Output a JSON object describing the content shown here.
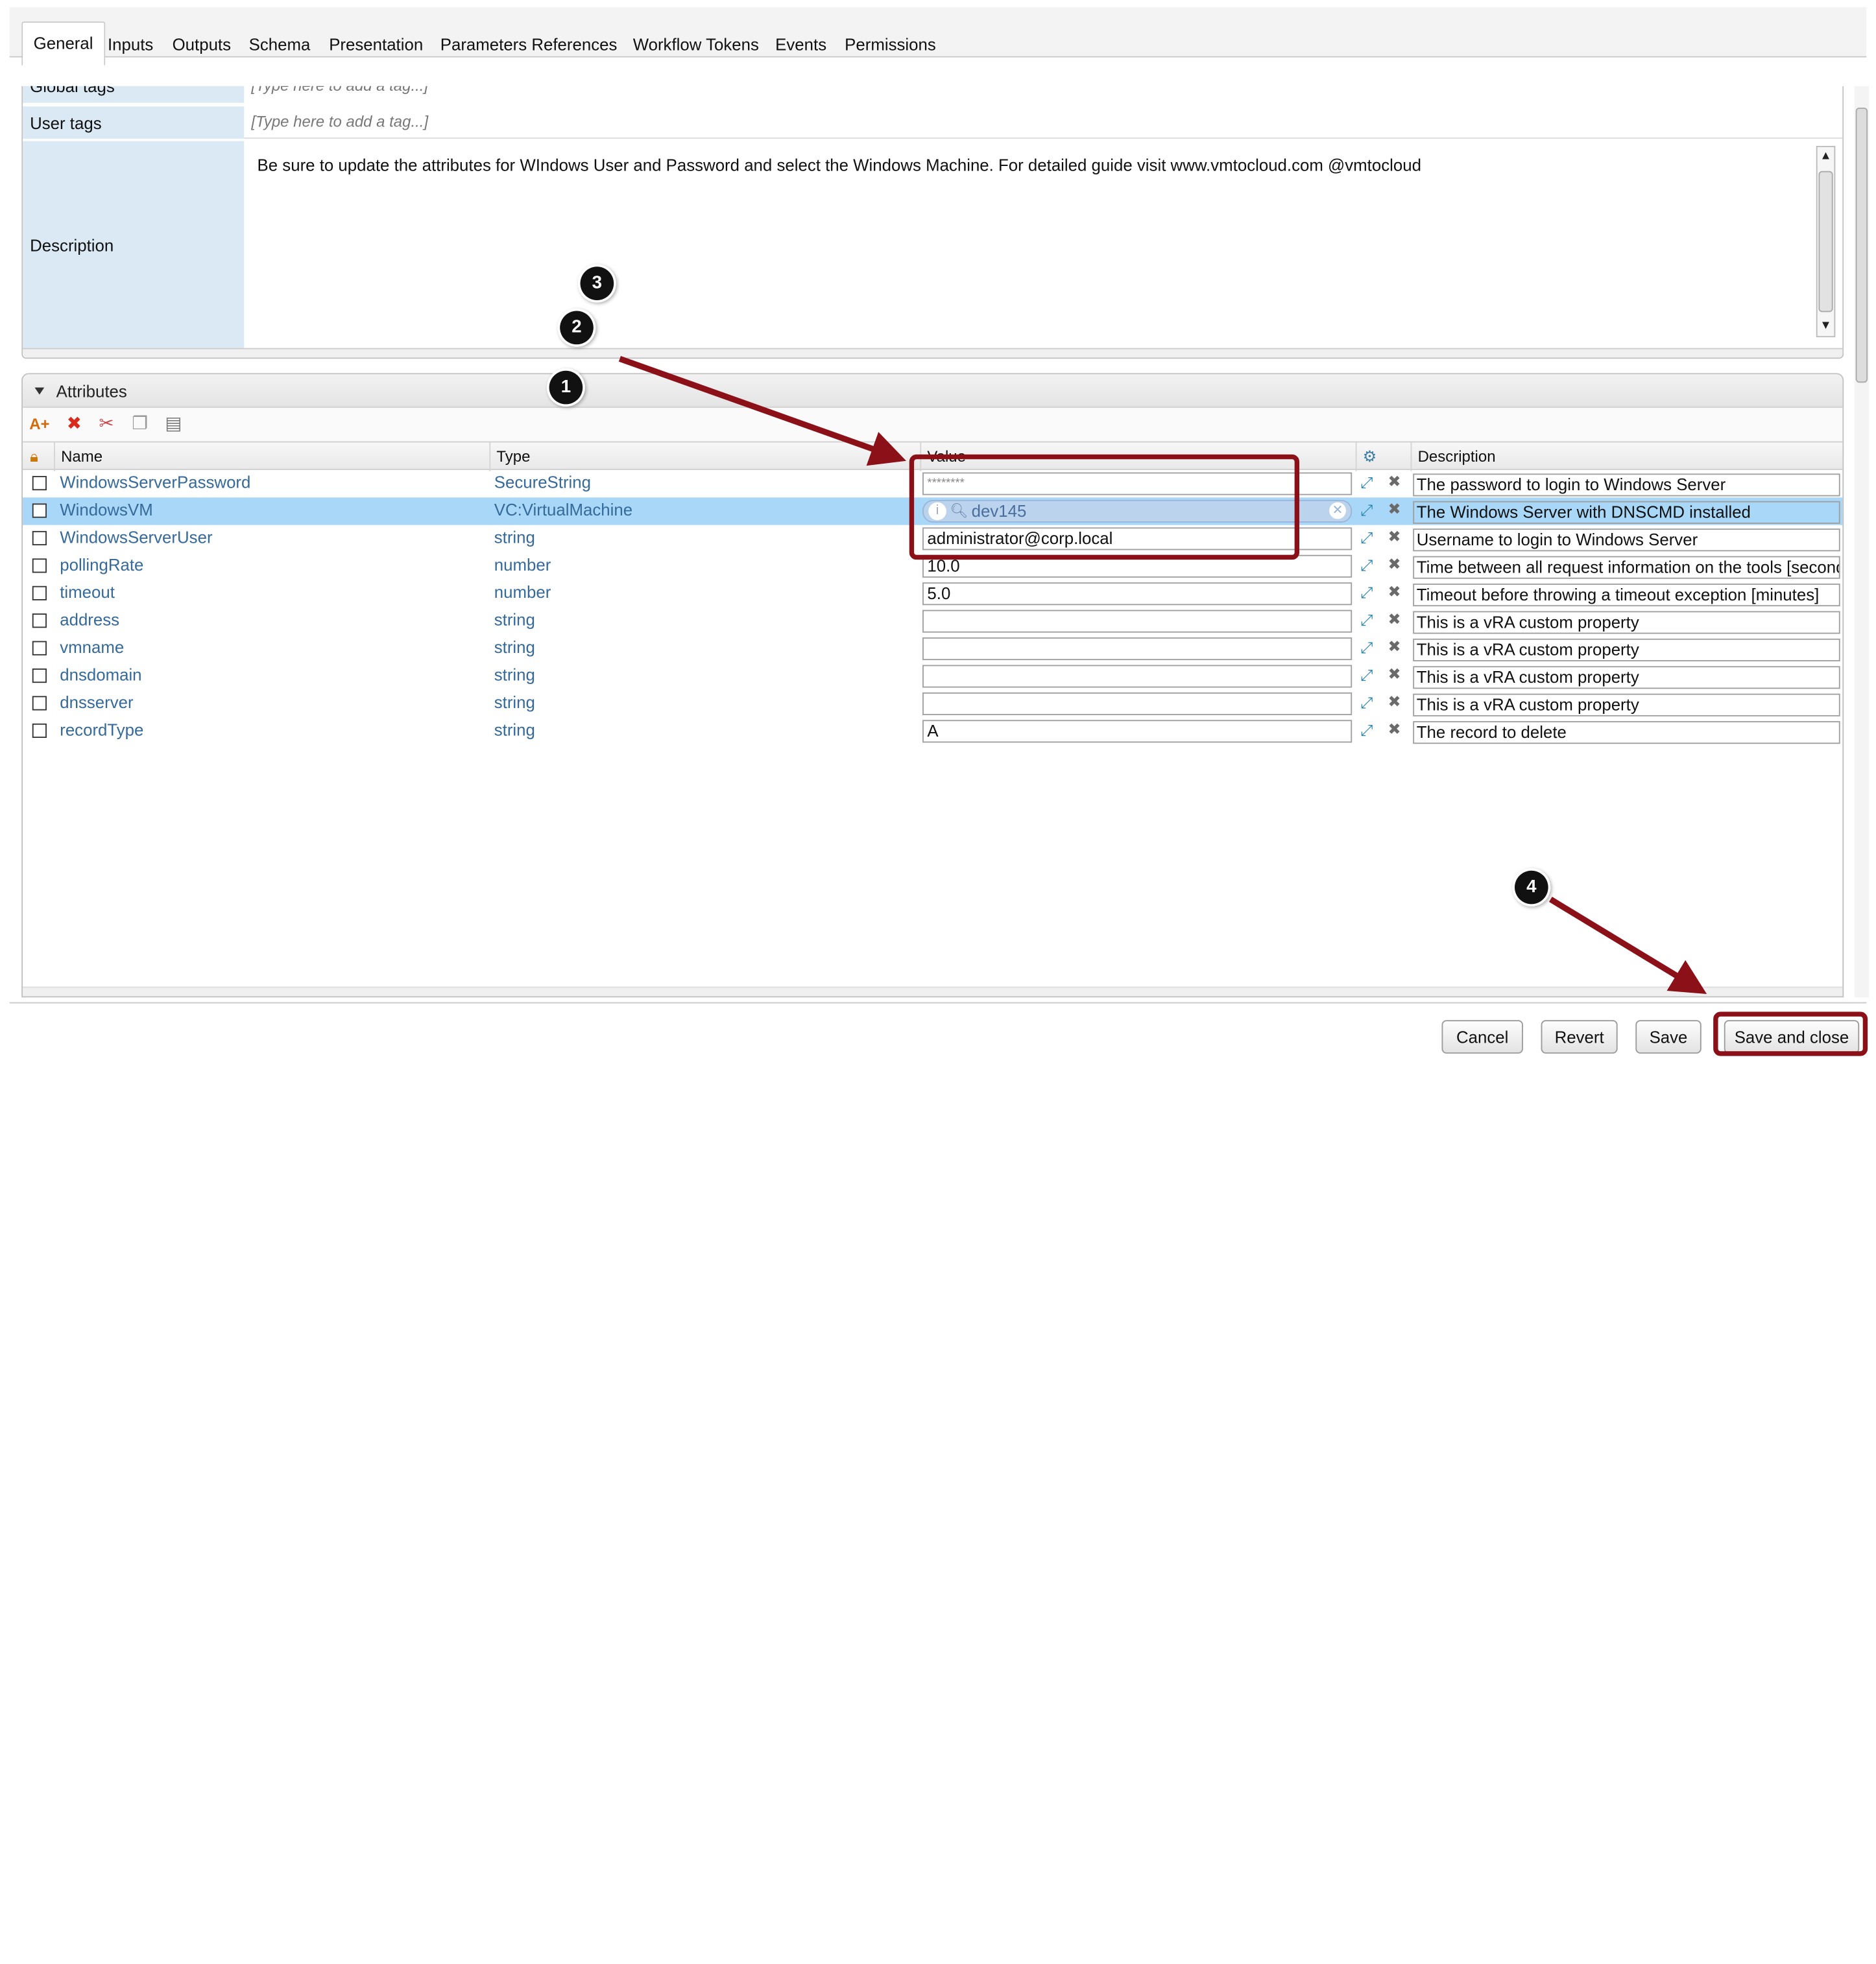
{
  "tabs": [
    {
      "label": "General",
      "active": true
    },
    {
      "label": "Inputs"
    },
    {
      "label": "Outputs"
    },
    {
      "label": "Schema"
    },
    {
      "label": "Presentation"
    },
    {
      "label": "Parameters References"
    },
    {
      "label": "Workflow Tokens"
    },
    {
      "label": "Events"
    },
    {
      "label": "Permissions"
    }
  ],
  "general": {
    "global_tags_label": "Global tags",
    "global_tags_placeholder": "[Type here to add a tag...]",
    "user_tags_label": "User tags",
    "user_tags_placeholder": "[Type here to add a tag...]",
    "description_label": "Description",
    "description_text": "Be sure to update the attributes for WIndows User and Password and select the Windows Machine. For detailed guide visit www.vmtocloud.com @vmtocloud"
  },
  "attributes": {
    "title": "Attributes",
    "columns": {
      "name": "Name",
      "type": "Type",
      "value": "Value",
      "description": "Description"
    },
    "rows": [
      {
        "name": "WindowsServerPassword",
        "type": "SecureString",
        "value": "********",
        "description": "The password to login to Windows Server"
      },
      {
        "name": "WindowsVM",
        "type": "VC:VirtualMachine",
        "value": "dev145",
        "description": "The Windows Server with DNSCMD installed",
        "selected": true
      },
      {
        "name": "WindowsServerUser",
        "type": "string",
        "value": "administrator@corp.local",
        "description": "Username to login to Windows Server"
      },
      {
        "name": "pollingRate",
        "type": "number",
        "value": "10.0",
        "description": "Time between all request information on the tools [seconds"
      },
      {
        "name": "timeout",
        "type": "number",
        "value": "5.0",
        "description": "Timeout before throwing a timeout exception [minutes]"
      },
      {
        "name": "address",
        "type": "string",
        "value": "",
        "description": "This is a vRA custom property"
      },
      {
        "name": "vmname",
        "type": "string",
        "value": "",
        "description": "This is a vRA custom property"
      },
      {
        "name": "dnsdomain",
        "type": "string",
        "value": "",
        "description": "This is a vRA custom property"
      },
      {
        "name": "dnsserver",
        "type": "string",
        "value": "",
        "description": "This is a vRA custom property"
      },
      {
        "name": "recordType",
        "type": "string",
        "value": "A",
        "description": "The record to delete"
      }
    ]
  },
  "buttons": {
    "cancel": "Cancel",
    "revert": "Revert",
    "save": "Save",
    "save_close": "Save and close"
  },
  "annotations": {
    "b1": "1",
    "b2": "2",
    "b3": "3",
    "b4": "4"
  },
  "colors": {
    "annotation": "#8b1017",
    "selected_row": "#a8d7f7",
    "label_bg": "#dbe9f5",
    "link": "#356a9a"
  }
}
